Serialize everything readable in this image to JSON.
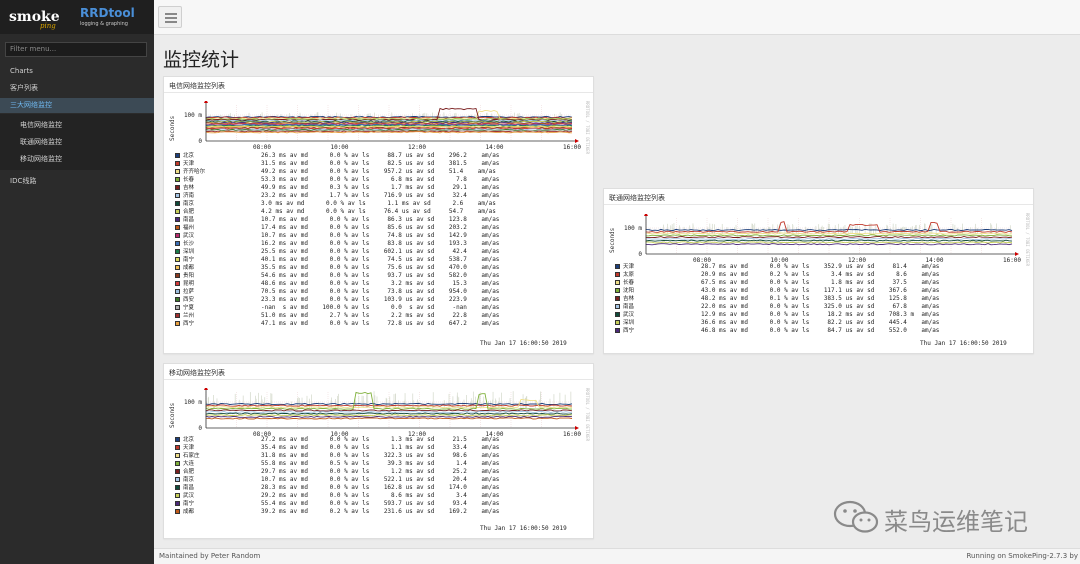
{
  "app": {
    "logo_main": "smoke",
    "logo_ping": "ping",
    "logo_rrd": "RRDtool",
    "logo_rrd_sub": "logging & graphing"
  },
  "sidebar": {
    "filter_placeholder": "Filter menu...",
    "items": [
      {
        "label": "Charts"
      },
      {
        "label": "客户列表"
      },
      {
        "label": "三大网络监控",
        "active": true
      },
      {
        "label": "IDC线路"
      }
    ],
    "subitems": [
      {
        "label": "电信网络监控"
      },
      {
        "label": "联通网络监控"
      },
      {
        "label": "移动网络监控"
      }
    ]
  },
  "main": {
    "page_title": "监控统计"
  },
  "panels": {
    "telecom": {
      "title": "电信网络监控列表",
      "ylabel": "Seconds",
      "side": "RRDTOOL / TOBI OETIKER",
      "y_tick": "100 m",
      "y_zero": "0",
      "x_ticks": [
        "08:00",
        "10:00",
        "12:00",
        "14:00",
        "16:00"
      ],
      "timestamp": "Thu Jan 17 16:00:50 2019",
      "rows": [
        {
          "name": "北京",
          "color": "#1c3f7c",
          "stats": "26.3 ms av md      0.0 % av ls     88.7 us av sd    296.2    am/as"
        },
        {
          "name": "天津",
          "color": "#c0392b",
          "stats": "31.5 ms av md      0.0 % av ls     82.5 us av sd    381.5    am/as"
        },
        {
          "name": "齐齐哈尔",
          "color": "#f0e08a",
          "stats": "49.2 ms av md      0.0 % av ls    957.2 us av sd    51.4    am/as"
        },
        {
          "name": "长春",
          "color": "#7fb03a",
          "stats": "53.3 ms av md      0.0 % av ls      6.8 ms av sd      7.8    am/as"
        },
        {
          "name": "吉林",
          "color": "#7a1f1f",
          "stats": "49.9 ms av md      0.3 % av ls      1.7 ms av sd     29.1    am/as"
        },
        {
          "name": "济南",
          "color": "#a7c7e7",
          "stats": "23.2 ms av md      1.7 % av ls    716.9 us av sd     32.4    am/as"
        },
        {
          "name": "南京",
          "color": "#0f4b3a",
          "stats": "3.0 ms av md      0.0 % av ls      1.1 ms av sd      2.6    am/as"
        },
        {
          "name": "合肥",
          "color": "#c8d05a",
          "stats": "4.2 ms av md      0.0 % av ls     76.4 us av sd     54.7    am/as"
        },
        {
          "name": "南昌",
          "color": "#4b2a7a",
          "stats": "10.7 ms av md      0.0 % av ls     86.3 us av sd    123.8    am/as"
        },
        {
          "name": "福州",
          "color": "#c05a1a",
          "stats": "17.4 ms av md      0.0 % av ls     85.6 us av sd    203.2    am/as"
        },
        {
          "name": "武汉",
          "color": "#b82a6e",
          "stats": "10.7 ms av md      0.0 % av ls     74.8 us av sd    142.9    am/as"
        },
        {
          "name": "长沙",
          "color": "#3b6fb6",
          "stats": "16.2 ms av md      0.0 % av ls     83.8 us av sd    193.3    am/as"
        },
        {
          "name": "深圳",
          "color": "#1a7a4a",
          "stats": "25.5 ms av md      0.0 % av ls    602.1 us av sd     42.4    am/as"
        },
        {
          "name": "南宁",
          "color": "#d8d860",
          "stats": "40.1 ms av md      0.0 % av ls     74.5 us av sd    538.7    am/as"
        },
        {
          "name": "成都",
          "color": "#f3c15a",
          "stats": "35.5 ms av md      0.0 % av ls     75.6 us av sd    470.0    am/as"
        },
        {
          "name": "贵阳",
          "color": "#8a3a20",
          "stats": "54.6 ms av md      0.0 % av ls     93.7 us av sd    582.0    am/as"
        },
        {
          "name": "昆明",
          "color": "#d23a3a",
          "stats": "48.6 ms av md      0.0 % av ls      3.2 ms av sd     15.3    am/as"
        },
        {
          "name": "拉萨",
          "color": "#9ec0e0",
          "stats": "70.5 ms av md      0.0 % av ls     73.8 us av sd    954.0    am/as"
        },
        {
          "name": "西安",
          "color": "#3d7a2a",
          "stats": "23.3 ms av md      0.0 % av ls    103.9 us av sd    223.9    am/as"
        },
        {
          "name": "宁夏",
          "color": "#b0b0b0",
          "stats": "-nan  s av md    100.0 % av ls      0.0  s av sd     -nan    am/as"
        },
        {
          "name": "兰州",
          "color": "#a03030",
          "stats": "51.0 ms av md      2.7 % av ls      2.2 ms av sd     22.8    am/as"
        },
        {
          "name": "西宁",
          "color": "#e8a040",
          "stats": "47.1 ms av md      0.0 % av ls     72.8 us av sd    647.2    am/as"
        }
      ]
    },
    "unicom": {
      "title": "联通网络监控列表",
      "ylabel": "Seconds",
      "side": "RRDTOOL / TOBI OETIKER",
      "y_tick": "100 m",
      "y_zero": "0",
      "x_ticks": [
        "08:00",
        "10:00",
        "12:00",
        "14:00",
        "16:00"
      ],
      "timestamp": "Thu Jan 17 16:00:50 2019",
      "rows": [
        {
          "name": "天津",
          "color": "#1c3f7c",
          "stats": "28.7 ms av md      0.0 % av ls    352.9 us av sd     81.4    am/as"
        },
        {
          "name": "太原",
          "color": "#c0392b",
          "stats": "20.9 ms av md      0.2 % av ls      3.4 ms av sd      8.6    am/as"
        },
        {
          "name": "长春",
          "color": "#f0e08a",
          "stats": "67.5 ms av md      0.0 % av ls      1.8 ms av sd     37.5    am/as"
        },
        {
          "name": "沈阳",
          "color": "#7fb03a",
          "stats": "43.0 ms av md      0.0 % av ls    117.1 us av sd    367.6    am/as"
        },
        {
          "name": "吉林",
          "color": "#7a1f1f",
          "stats": "48.2 ms av md      0.1 % av ls    383.5 us av sd    125.8    am/as"
        },
        {
          "name": "南昌",
          "color": "#a7c7e7",
          "stats": "22.0 ms av md      0.0 % av ls    325.0 us av sd     67.8    am/as"
        },
        {
          "name": "武汉",
          "color": "#0f4b3a",
          "stats": "12.9 ms av md      0.0 % av ls     18.2 ms av sd    708.3 m  am/as"
        },
        {
          "name": "深圳",
          "color": "#c8d05a",
          "stats": "36.6 ms av md      0.0 % av ls     82.2 us av sd    445.4    am/as"
        },
        {
          "name": "西宁",
          "color": "#4b2a7a",
          "stats": "46.8 ms av md      0.0 % av ls     84.7 us av sd    552.0    am/as"
        }
      ]
    },
    "mobile": {
      "title": "移动网络监控列表",
      "ylabel": "Seconds",
      "side": "RRDTOOL / TOBI OETIKER",
      "y_tick": "100 m",
      "y_zero": "0",
      "x_ticks": [
        "08:00",
        "10:00",
        "12:00",
        "14:00",
        "16:00"
      ],
      "timestamp": "Thu Jan 17 16:00:50 2019",
      "rows": [
        {
          "name": "北京",
          "color": "#1c3f7c",
          "stats": "27.2 ms av md      0.0 % av ls      1.3 ms av sd     21.5    am/as"
        },
        {
          "name": "天津",
          "color": "#c0392b",
          "stats": "35.4 ms av md      0.0 % av ls      1.1 ms av sd     33.4    am/as"
        },
        {
          "name": "石家庄",
          "color": "#f0e08a",
          "stats": "31.8 ms av md      0.0 % av ls    322.3 us av sd     98.6    am/as"
        },
        {
          "name": "大连",
          "color": "#7fb03a",
          "stats": "55.8 ms av md      0.5 % av ls     39.3 ms av sd      1.4    am/as"
        },
        {
          "name": "合肥",
          "color": "#7a1f1f",
          "stats": "29.7 ms av md      0.0 % av ls      1.2 ms av sd     25.2    am/as"
        },
        {
          "name": "南京",
          "color": "#a7c7e7",
          "stats": "10.7 ms av md      0.0 % av ls    522.1 us av sd     20.4    am/as"
        },
        {
          "name": "南昌",
          "color": "#0f4b3a",
          "stats": "28.3 ms av md      0.0 % av ls    162.8 us av sd    174.0    am/as"
        },
        {
          "name": "武汉",
          "color": "#c8d05a",
          "stats": "29.2 ms av md      0.0 % av ls      8.6 ms av sd      3.4    am/as"
        },
        {
          "name": "南宁",
          "color": "#4b2a7a",
          "stats": "55.4 ms av md      0.0 % av ls    593.7 us av sd     93.4    am/as"
        },
        {
          "name": "成都",
          "color": "#c05a1a",
          "stats": "39.2 ms av md      0.2 % av ls    231.6 us av sd    169.2    am/as"
        }
      ]
    }
  },
  "footer": {
    "left": "Maintained by Peter Random",
    "right": "Running on SmokePing-2.7.3 by"
  },
  "watermark": {
    "text": "菜鸟运维笔记",
    "icon": "wechat-icon"
  },
  "colors": {
    "sidebar_bg": "#2b2b2b",
    "sidebar_active_text": "#6fb7ee",
    "logo_rrd": "#4a8fd8",
    "logo_ping": "#d9a400"
  }
}
